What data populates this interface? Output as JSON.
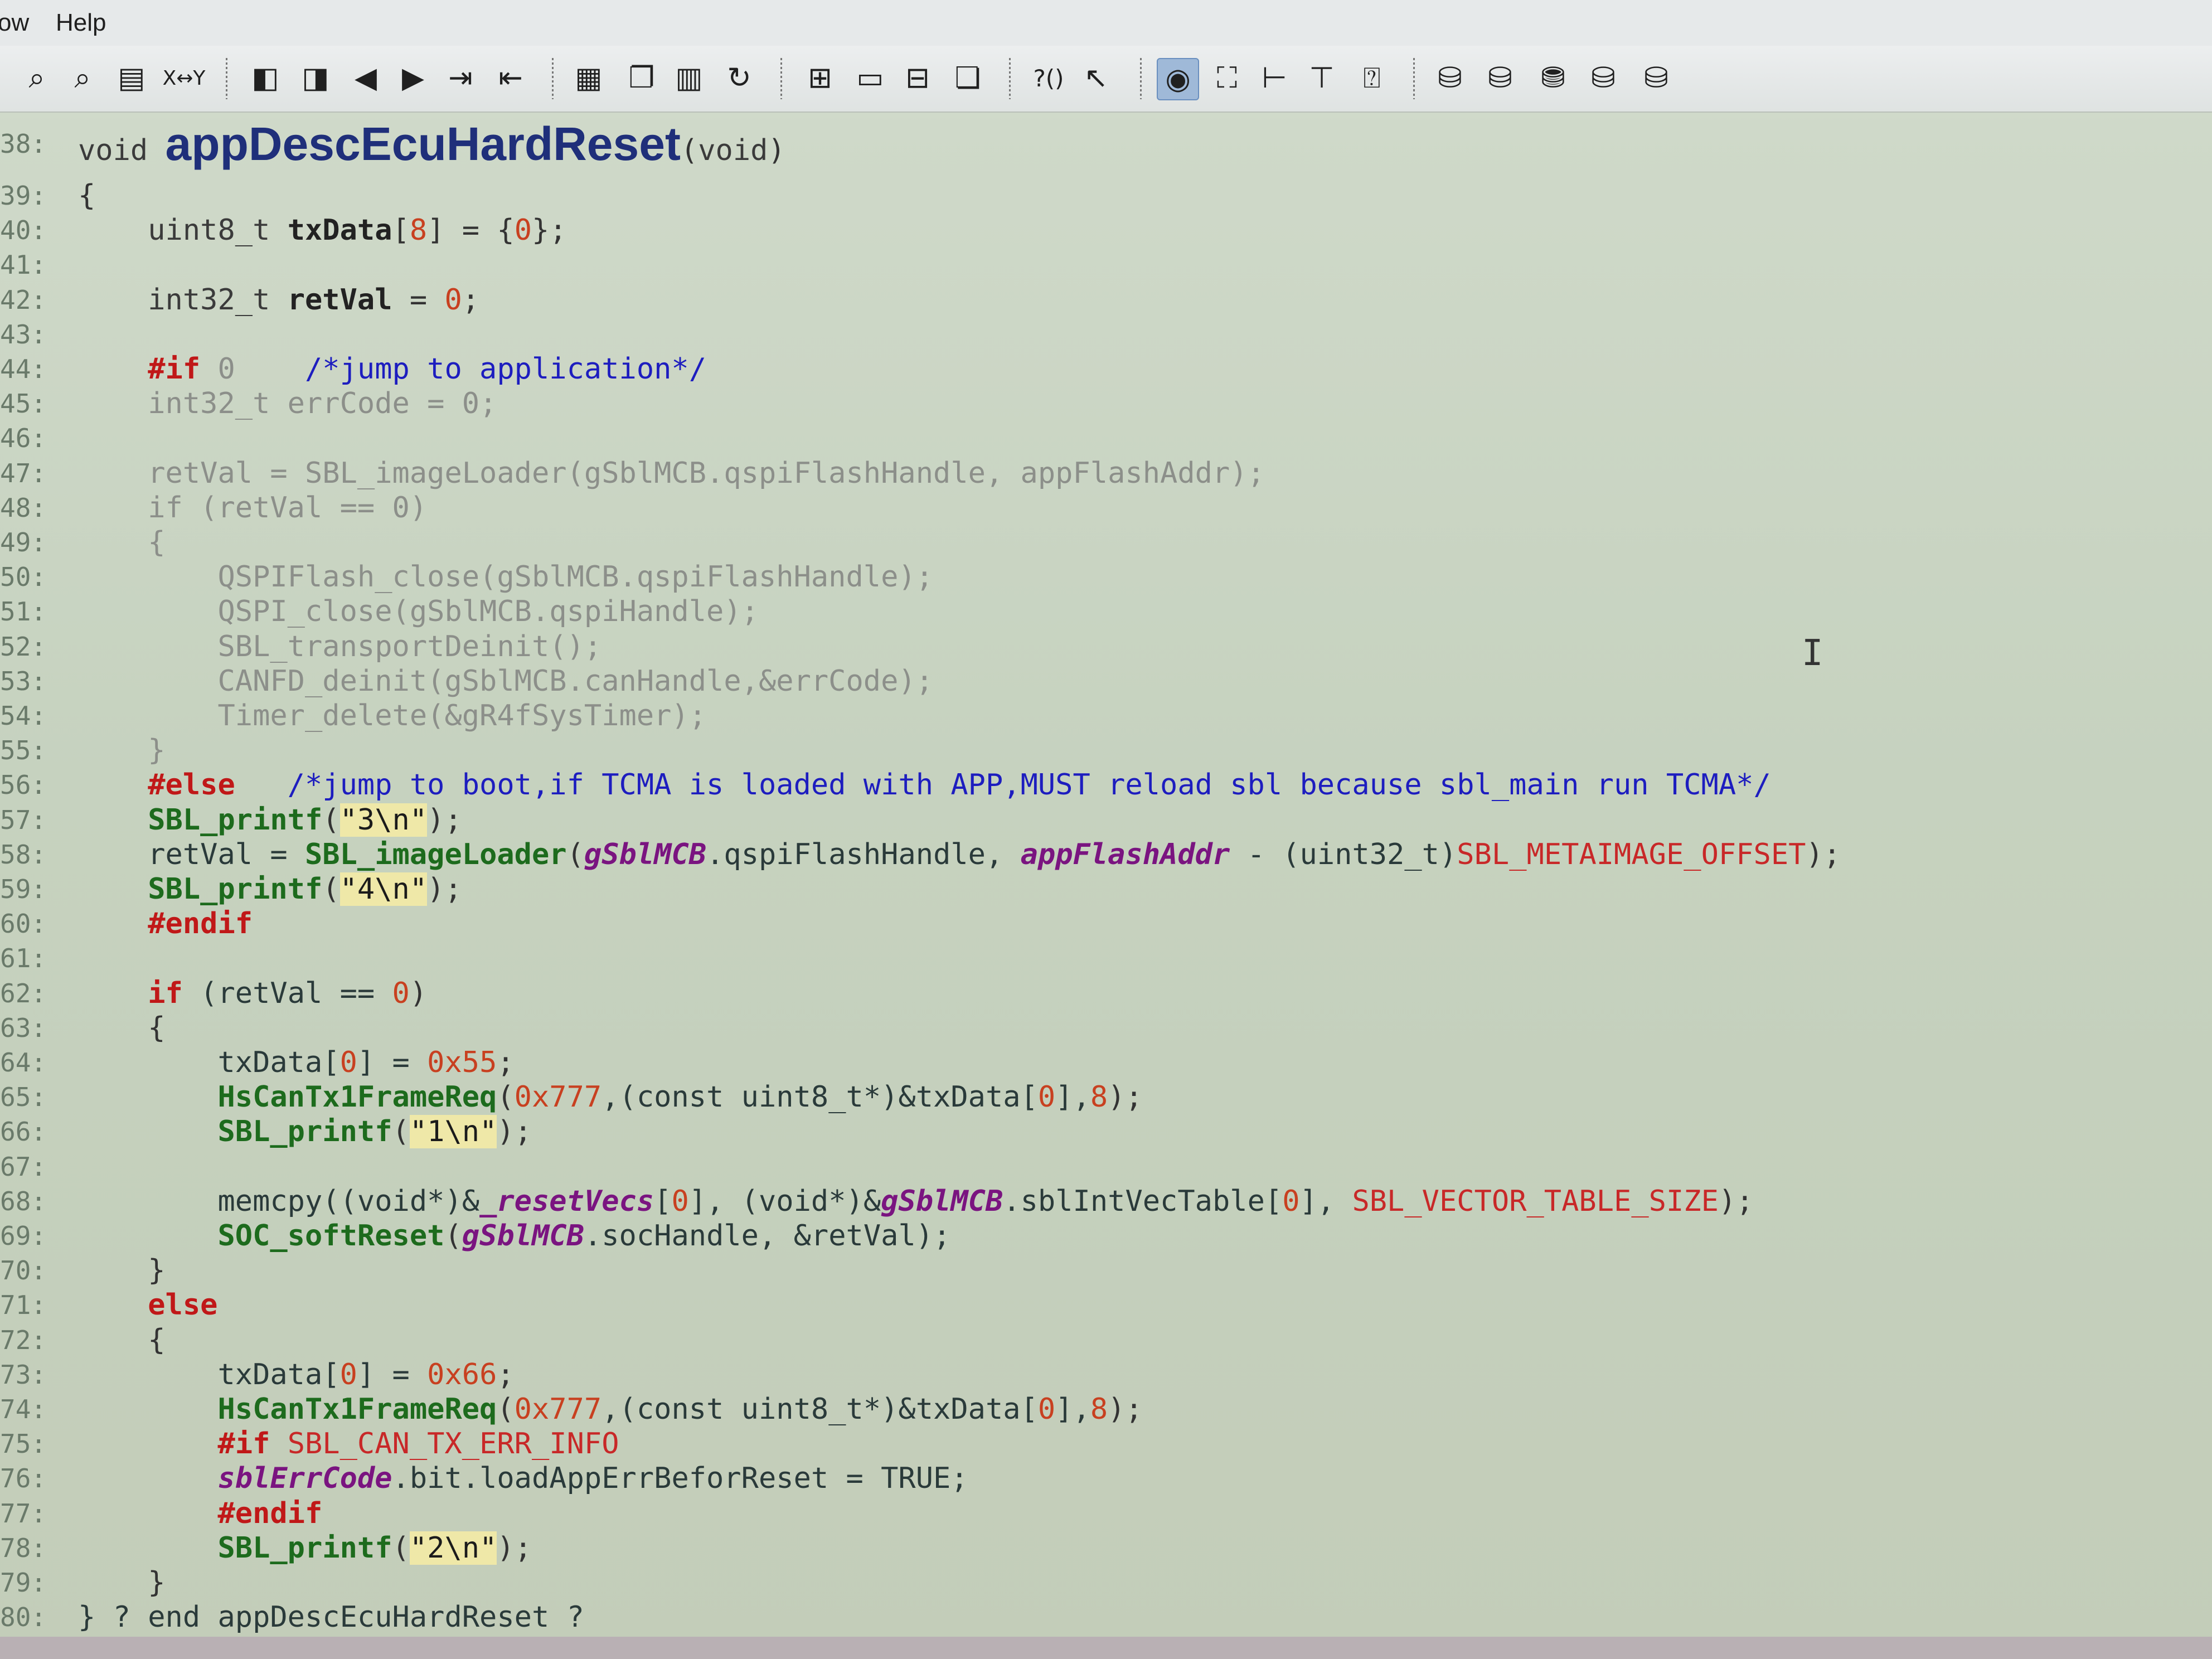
{
  "menu": {
    "items": [
      "ow",
      "Help"
    ]
  },
  "toolbar": {
    "groups": [
      [
        "binoculars-icon",
        "binoculars-2-icon",
        "find-in-files-icon",
        "replace-icon"
      ],
      [
        "bookmark-prev-icon",
        "bookmark-next-icon",
        "back-arrow-icon",
        "forward-arrow-icon",
        "indent-icon",
        "outdent-icon"
      ],
      [
        "lock-icon",
        "copy-icon",
        "book-icon",
        "redo-icon"
      ],
      [
        "grid-icon",
        "window-icon",
        "window-split-icon",
        "cascade-icon"
      ],
      [
        "help-paren-icon",
        "help-cursor-icon"
      ],
      [
        "eye-icon",
        "image-select-icon",
        "tree-icon",
        "hierarchy-icon",
        "help-box-icon"
      ],
      [
        "db-1-icon",
        "db-2-icon",
        "db-3-icon",
        "db-4-icon",
        "db-5-icon"
      ]
    ],
    "xy_label": "X↔Y",
    "active_index": 0
  },
  "editor": {
    "function_name": "appDescEcuHardReset",
    "lines": [
      {
        "n": "38:",
        "segs": [
          [
            "type",
            "void "
          ],
          [
            "title",
            "appDescEcuHardReset"
          ],
          [
            "punc",
            "("
          ],
          [
            "type",
            "void"
          ],
          [
            "punc",
            ")"
          ]
        ]
      },
      {
        "n": "39:",
        "segs": [
          [
            "punc",
            "{"
          ]
        ]
      },
      {
        "n": "40:",
        "segs": [
          [
            "type",
            "    uint8_t "
          ],
          [
            "var",
            "txData"
          ],
          [
            "punc",
            "["
          ],
          [
            "num",
            "8"
          ],
          [
            "punc",
            "] = {"
          ],
          [
            "num",
            "0"
          ],
          [
            "punc",
            "};"
          ]
        ]
      },
      {
        "n": "41:",
        "segs": []
      },
      {
        "n": "42:",
        "segs": [
          [
            "type",
            "    int32_t "
          ],
          [
            "var",
            "retVal"
          ],
          [
            "punc",
            " = "
          ],
          [
            "num",
            "0"
          ],
          [
            "punc",
            ";"
          ]
        ]
      },
      {
        "n": "43:",
        "segs": []
      },
      {
        "n": "44:",
        "segs": [
          [
            "kw",
            "    #if "
          ],
          [
            "dim",
            "0"
          ],
          [
            "cmt",
            "    /*jump to application*/"
          ]
        ]
      },
      {
        "n": "45:",
        "segs": [
          [
            "dim",
            "    int32_t errCode = 0;"
          ]
        ]
      },
      {
        "n": "46:",
        "segs": []
      },
      {
        "n": "47:",
        "segs": [
          [
            "dim",
            "    retVal = SBL_imageLoader(gSblMCB.qspiFlashHandle, appFlashAddr);"
          ]
        ]
      },
      {
        "n": "48:",
        "segs": [
          [
            "dim",
            "    if (retVal == 0)"
          ]
        ]
      },
      {
        "n": "49:",
        "segs": [
          [
            "dim",
            "    {"
          ]
        ]
      },
      {
        "n": "50:",
        "segs": [
          [
            "dim",
            "        QSPIFlash_close(gSblMCB.qspiFlashHandle);"
          ]
        ]
      },
      {
        "n": "51:",
        "segs": [
          [
            "dim",
            "        QSPI_close(gSblMCB.qspiHandle);"
          ]
        ]
      },
      {
        "n": "52:",
        "segs": [
          [
            "dim",
            "        SBL_transportDeinit();"
          ]
        ]
      },
      {
        "n": "53:",
        "segs": [
          [
            "dim",
            "        CANFD_deinit(gSblMCB.canHandle,&errCode);"
          ]
        ]
      },
      {
        "n": "54:",
        "segs": [
          [
            "dim",
            "        Timer_delete(&gR4fSysTimer);"
          ]
        ]
      },
      {
        "n": "55:",
        "segs": [
          [
            "dim",
            "    }"
          ]
        ]
      },
      {
        "n": "56:",
        "segs": [
          [
            "kw",
            "    #else"
          ],
          [
            "cmt",
            "   /*jump to boot,if TCMA is loaded with APP,MUST reload sbl because sbl_main run TCMA*/"
          ]
        ]
      },
      {
        "n": "57:",
        "segs": [
          [
            "fn",
            "    SBL_printf"
          ],
          [
            "punc",
            "("
          ],
          [
            "str",
            "\"3\\n\""
          ],
          [
            "punc",
            ");"
          ]
        ]
      },
      {
        "n": "58:",
        "segs": [
          [
            "plain",
            "    retVal = "
          ],
          [
            "fn",
            "SBL_imageLoader"
          ],
          [
            "punc",
            "("
          ],
          [
            "glob",
            "gSblMCB"
          ],
          [
            "plain",
            ".qspiFlashHandle, "
          ],
          [
            "glob",
            "appFlashAddr"
          ],
          [
            "plain",
            " - (uint32_t)"
          ],
          [
            "macro",
            "SBL_METAIMAGE_OFFSET"
          ],
          [
            "punc",
            ");"
          ]
        ]
      },
      {
        "n": "59:",
        "segs": [
          [
            "fn",
            "    SBL_printf"
          ],
          [
            "punc",
            "("
          ],
          [
            "str",
            "\"4\\n\""
          ],
          [
            "punc",
            ");"
          ]
        ]
      },
      {
        "n": "60:",
        "segs": [
          [
            "kw",
            "    #endif"
          ]
        ]
      },
      {
        "n": "61:",
        "segs": []
      },
      {
        "n": "62:",
        "segs": [
          [
            "kw",
            "    if "
          ],
          [
            "plain",
            "(retVal == "
          ],
          [
            "num",
            "0"
          ],
          [
            "punc",
            ")"
          ]
        ]
      },
      {
        "n": "63:",
        "segs": [
          [
            "punc",
            "    {"
          ]
        ]
      },
      {
        "n": "64:",
        "segs": [
          [
            "plain",
            "        txData["
          ],
          [
            "num",
            "0"
          ],
          [
            "plain",
            "] = "
          ],
          [
            "num",
            "0x55"
          ],
          [
            "punc",
            ";"
          ]
        ]
      },
      {
        "n": "65:",
        "segs": [
          [
            "fn",
            "        HsCanTx1FrameReq"
          ],
          [
            "punc",
            "("
          ],
          [
            "num",
            "0x777"
          ],
          [
            "plain",
            ",(const uint8_t*)&txData["
          ],
          [
            "num",
            "0"
          ],
          [
            "plain",
            "],"
          ],
          [
            "num",
            "8"
          ],
          [
            "punc",
            ");"
          ]
        ]
      },
      {
        "n": "66:",
        "segs": [
          [
            "fn",
            "        SBL_printf"
          ],
          [
            "punc",
            "("
          ],
          [
            "str",
            "\"1\\n\""
          ],
          [
            "punc",
            ");"
          ]
        ]
      },
      {
        "n": "67:",
        "segs": []
      },
      {
        "n": "68:",
        "segs": [
          [
            "plain",
            "        memcpy((void*)&"
          ],
          [
            "glob",
            "_resetVecs"
          ],
          [
            "plain",
            "["
          ],
          [
            "num",
            "0"
          ],
          [
            "plain",
            "], (void*)&"
          ],
          [
            "glob",
            "gSblMCB"
          ],
          [
            "plain",
            ".sblIntVecTable["
          ],
          [
            "num",
            "0"
          ],
          [
            "plain",
            "], "
          ],
          [
            "macro",
            "SBL_VECTOR_TABLE_SIZE"
          ],
          [
            "punc",
            ");"
          ]
        ]
      },
      {
        "n": "69:",
        "segs": [
          [
            "fn",
            "        SOC_softReset"
          ],
          [
            "punc",
            "("
          ],
          [
            "glob",
            "gSblMCB"
          ],
          [
            "plain",
            ".socHandle, &retVal);"
          ]
        ]
      },
      {
        "n": "70:",
        "segs": [
          [
            "punc",
            "    }"
          ]
        ]
      },
      {
        "n": "71:",
        "segs": [
          [
            "kw",
            "    else"
          ]
        ]
      },
      {
        "n": "72:",
        "segs": [
          [
            "punc",
            "    {"
          ]
        ]
      },
      {
        "n": "73:",
        "segs": [
          [
            "plain",
            "        txData["
          ],
          [
            "num",
            "0"
          ],
          [
            "plain",
            "] = "
          ],
          [
            "num",
            "0x66"
          ],
          [
            "punc",
            ";"
          ]
        ]
      },
      {
        "n": "74:",
        "segs": [
          [
            "fn",
            "        HsCanTx1FrameReq"
          ],
          [
            "punc",
            "("
          ],
          [
            "num",
            "0x777"
          ],
          [
            "plain",
            ",(const uint8_t*)&txData["
          ],
          [
            "num",
            "0"
          ],
          [
            "plain",
            "],"
          ],
          [
            "num",
            "8"
          ],
          [
            "punc",
            ");"
          ]
        ]
      },
      {
        "n": "75:",
        "segs": [
          [
            "kw",
            "        #if "
          ],
          [
            "macro",
            "SBL_CAN_TX_ERR_INFO"
          ]
        ]
      },
      {
        "n": "76:",
        "segs": [
          [
            "glob",
            "        sblErrCode"
          ],
          [
            "plain",
            ".bit.loadAppErrBeforReset = TRUE;"
          ]
        ]
      },
      {
        "n": "77:",
        "segs": [
          [
            "kw",
            "        #endif"
          ]
        ]
      },
      {
        "n": "78:",
        "segs": [
          [
            "fn",
            "        SBL_printf"
          ],
          [
            "punc",
            "("
          ],
          [
            "str",
            "\"2\\n\""
          ],
          [
            "punc",
            ");"
          ]
        ]
      },
      {
        "n": "79:",
        "segs": [
          [
            "punc",
            "    }"
          ]
        ]
      },
      {
        "n": "80:",
        "segs": [
          [
            "plain",
            "} ? end appDescEcuHardReset ?"
          ]
        ]
      }
    ]
  },
  "colors": {
    "background": "#c6d2bf",
    "keyword": "#c01818",
    "function": "#1d6b1d",
    "comment": "#1d1dbf",
    "global": "#7a1480"
  }
}
